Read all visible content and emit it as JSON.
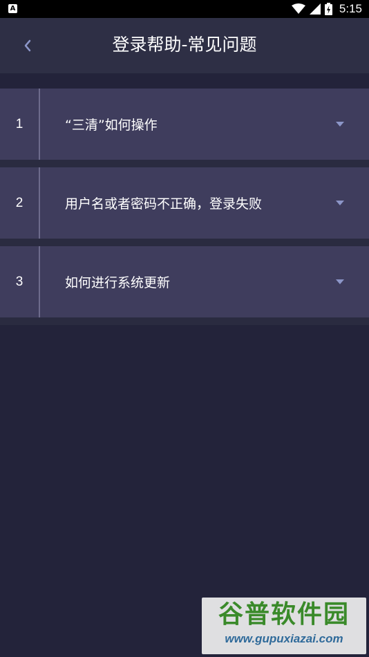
{
  "status_bar": {
    "app_icon_letter": "A",
    "time": "5:15",
    "icons": [
      "wifi-icon",
      "signal-icon",
      "battery-icon"
    ]
  },
  "header": {
    "back_icon": "chevron-left-icon",
    "title": "登录帮助-常见问题"
  },
  "faq": {
    "items": [
      {
        "number": "1",
        "question": "“三清”如何操作"
      },
      {
        "number": "2",
        "question": "用户名或者密码不正确，登录失败"
      },
      {
        "number": "3",
        "question": "如何进行系统更新"
      }
    ],
    "arrow_icon": "caret-down-icon"
  },
  "watermark": {
    "brand": "谷普软件园",
    "url": "www.gupuxiazai.com"
  },
  "colors": {
    "background": "#23233a",
    "header": "#2e2f45",
    "item": "#3f3d5d",
    "accent_icon": "#8c96c8",
    "watermark_green": "#3a8a2a",
    "watermark_blue": "#2f6a9a"
  }
}
